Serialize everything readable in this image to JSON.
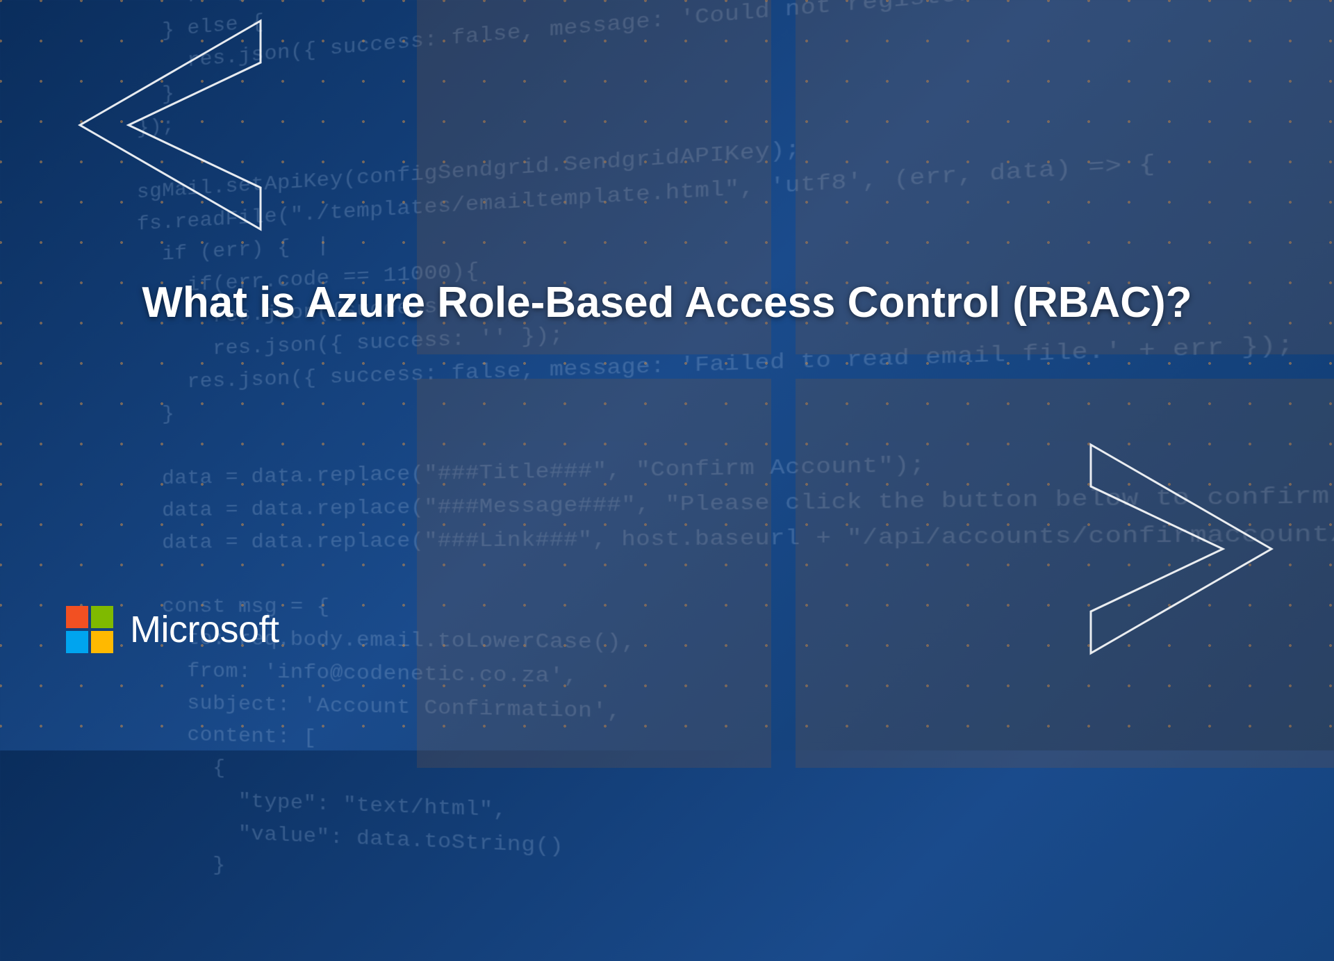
{
  "title": "What is Azure Role-Based Access Control (RBAC)?",
  "brand": "Microsoft",
  "code_lines": "      res.json({ success: false, message: 'Could not register user. Error: ' + err });\n    } else {\n      res.json({ success: false, message: 'Could not register user. Error: ' + err });\n    }\n  });\n\n  sgMail.setApiKey(configSendgrid.SendgridAPIKey);\n  fs.readFile(\"./templates/emailtemplate.html\", 'utf8', (err, data) => {\n    if (err) {  |\n      if(err.code == 11000){\n        res.json({success\n        res.json({ success: '' });\n      res.json({ success: false, message: 'Failed to read email file.' + err });\n    }\n\n    data = data.replace(\"###Title###\", \"Confirm Account\");\n    data = data.replace(\"###Message###\", \"Please click the button below to confirm your account\");\n    data = data.replace(\"###Link###\", host.baseurl + \"/api/accounts/confirmaccount/\" + newUser.confirmToken);\n\n    const msg = {\n      to: req.body.email.toLowerCase(),\n      from: 'info@codenetic.co.za',\n      subject: 'Account Confirmation',\n      content: [\n        {\n          \"type\": \"text/html\",\n          \"value\": data.toString()\n        }"
}
